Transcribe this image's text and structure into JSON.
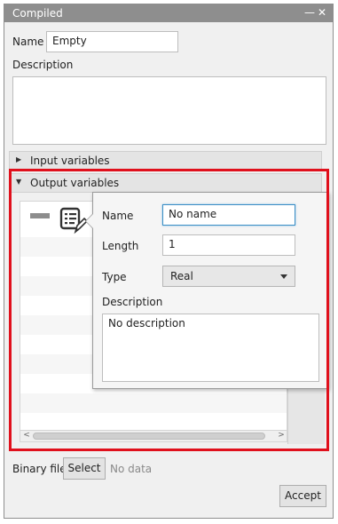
{
  "window": {
    "title": "Compiled",
    "minimize_glyph": "—",
    "close_glyph": "✕"
  },
  "form": {
    "name_label": "Name",
    "name_value": "Empty",
    "description_label": "Description",
    "description_value": ""
  },
  "sections": {
    "input": {
      "label": "Input variables",
      "expanded": false,
      "arrow": "▶"
    },
    "output": {
      "label": "Output variables",
      "expanded": true,
      "arrow": "▼"
    }
  },
  "highlight_color": "#e0101c",
  "icons": {
    "remove": "minus-icon",
    "edit": "edit-list-icon",
    "add": "plus-icon"
  },
  "popup": {
    "name_label": "Name",
    "name_value": "No name",
    "length_label": "Length",
    "length_value": "1",
    "type_label": "Type",
    "type_value": "Real",
    "description_label": "Description",
    "description_value": "No description"
  },
  "scrollbar": {
    "left_arrow": "<",
    "right_arrow": ">"
  },
  "binary": {
    "label": "Binary file",
    "select_label": "Select",
    "status": "No data"
  },
  "footer": {
    "accept_label": "Accept"
  }
}
